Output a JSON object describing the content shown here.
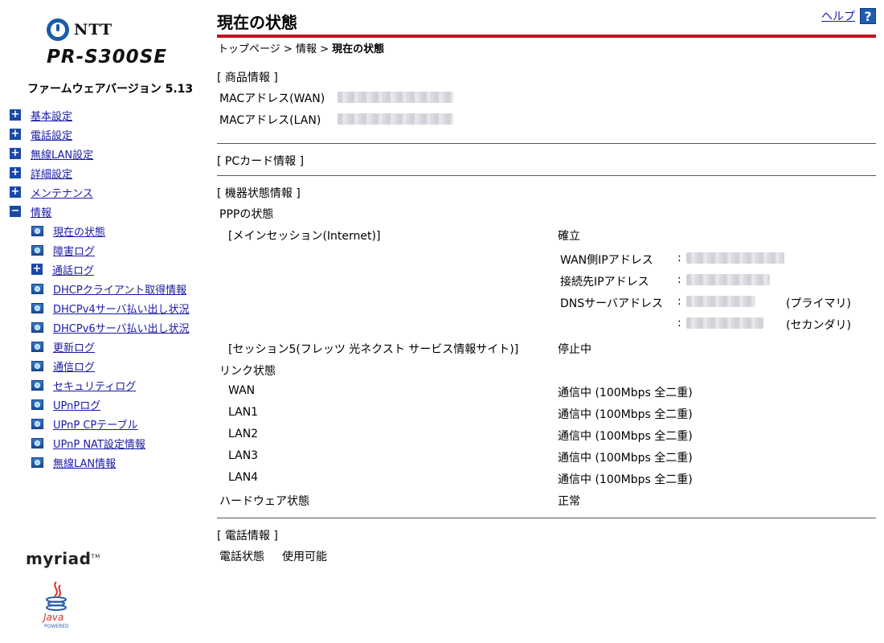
{
  "brand": {
    "company": "NTT",
    "model": "PR-S300SE"
  },
  "firmware": {
    "label": "ファームウェアバージョン 5.13"
  },
  "menu": [
    {
      "label": "基本設定",
      "icon": "plus-icon"
    },
    {
      "label": "電話設定",
      "icon": "plus-icon"
    },
    {
      "label": "無線LAN設定",
      "icon": "plus-icon"
    },
    {
      "label": "詳細設定",
      "icon": "plus-icon"
    },
    {
      "label": "メンテナンス",
      "icon": "plus-icon"
    },
    {
      "label": "情報",
      "icon": "minus-icon"
    }
  ],
  "submenu": [
    {
      "label": "現在の状態",
      "icon": "page-icon"
    },
    {
      "label": "障害ログ",
      "icon": "page-icon"
    },
    {
      "label": "通話ログ",
      "icon": "plus-icon"
    },
    {
      "label": "DHCPクライアント取得情報",
      "icon": "page-icon"
    },
    {
      "label": "DHCPv4サーバ払い出し状況",
      "icon": "page-icon"
    },
    {
      "label": "DHCPv6サーバ払い出し状況",
      "icon": "page-icon"
    },
    {
      "label": "更新ログ",
      "icon": "page-icon"
    },
    {
      "label": "通信ログ",
      "icon": "page-icon"
    },
    {
      "label": "セキュリティログ",
      "icon": "page-icon"
    },
    {
      "label": "UPnPログ",
      "icon": "page-icon"
    },
    {
      "label": "UPnP CPテーブル",
      "icon": "page-icon"
    },
    {
      "label": "UPnP NAT設定情報",
      "icon": "page-icon"
    },
    {
      "label": "無線LAN情報",
      "icon": "page-icon"
    }
  ],
  "footer_logos": {
    "myriad": "myriad",
    "tm": "TM",
    "java": "Java",
    "java_powered": "POWERED"
  },
  "header": {
    "title": "現在の状態",
    "help_label": "ヘルプ",
    "help_icon": "?",
    "breadcrumb": {
      "top": "トップページ",
      "sep": ">",
      "info": "情報",
      "current": "現在の状態"
    }
  },
  "product": {
    "section": "[ 商品情報 ]",
    "mac_wan_label": "MACアドレス(WAN)",
    "mac_lan_label": "MACアドレス(LAN)"
  },
  "pccard": {
    "section": "[ PCカード情報 ]"
  },
  "device": {
    "section": "[ 機器状態情報 ]",
    "ppp_label": "PPPの状態",
    "main_session_label": "[メインセッション(Internet)]",
    "main_session_status": "確立",
    "wan_ip_label": "WAN側IPアドレス",
    "peer_ip_label": "接続先IPアドレス",
    "dns_label": "DNSサーバアドレス",
    "colon": ":",
    "dns_primary": "(プライマリ)",
    "dns_secondary": "(セカンダリ)",
    "session5_label": "[セッション5(フレッツ 光ネクスト サービス情報サイト)]",
    "session5_status": "停止中",
    "link_label": "リンク状態",
    "links": [
      {
        "name": "WAN",
        "status": "通信中 (100Mbps 全二重)"
      },
      {
        "name": "LAN1",
        "status": "通信中 (100Mbps 全二重)"
      },
      {
        "name": "LAN2",
        "status": "通信中 (100Mbps 全二重)"
      },
      {
        "name": "LAN3",
        "status": "通信中 (100Mbps 全二重)"
      },
      {
        "name": "LAN4",
        "status": "通信中 (100Mbps 全二重)"
      }
    ],
    "hardware_label": "ハードウェア状態",
    "hardware_status": "正常"
  },
  "phone": {
    "section": "[ 電話情報 ]",
    "status_label": "電話状態",
    "status_value": "使用可能"
  },
  "colors": {
    "accent_rule": "#c0141c",
    "link": "#1a1aa6",
    "icon_blue": "#1b48a8"
  }
}
